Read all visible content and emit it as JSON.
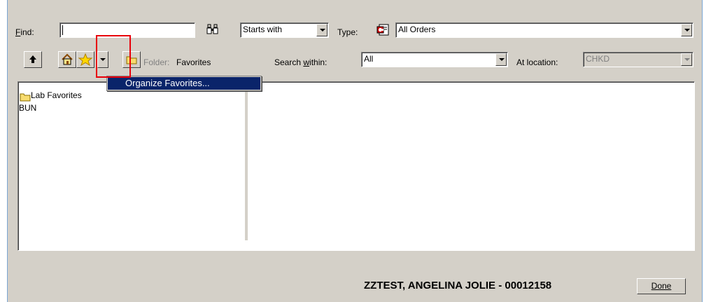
{
  "find": {
    "label": "Find:",
    "value": ""
  },
  "match_mode": {
    "value": "Starts with"
  },
  "type": {
    "label": "Type:",
    "value": "All Orders"
  },
  "folder": {
    "label": "Folder:",
    "name": "Favorites"
  },
  "search_within": {
    "label": "Search within:",
    "value": "All"
  },
  "at_location": {
    "label": "At location:",
    "value": "CHKD"
  },
  "favorites_menu": {
    "items": [
      "Organize Favorites..."
    ]
  },
  "tree": {
    "items": [
      {
        "label": "Lab Favorites",
        "icon": "folder-icon"
      },
      {
        "label": "BUN"
      }
    ]
  },
  "patient_banner": {
    "text": "ZZTEST, ANGELINA JOLIE - 00012158"
  },
  "done_button": {
    "label": "Done"
  },
  "colors": {
    "highlight": "#0a246a",
    "annotation": "#e8000b",
    "face": "#d4d0c8"
  }
}
